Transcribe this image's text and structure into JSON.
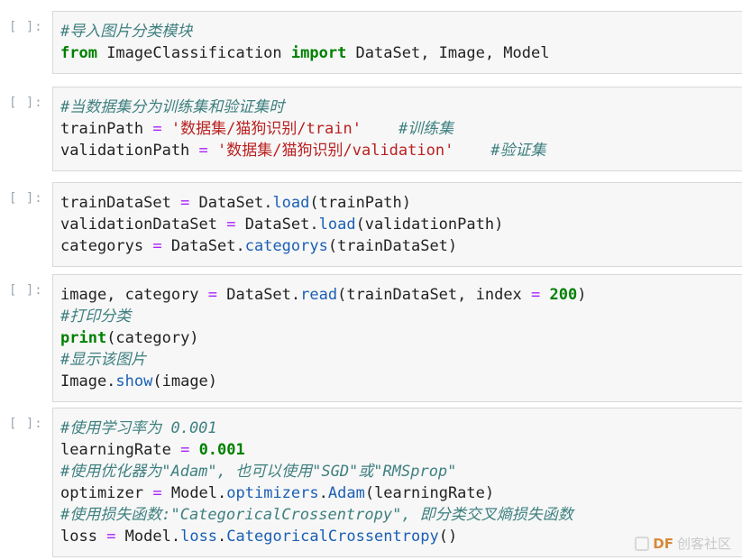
{
  "cells": [
    {
      "prompt": "[ ]:",
      "lines": [
        [
          {
            "t": "#导入图片分类模块",
            "c": "cm"
          }
        ],
        [
          {
            "t": "from",
            "c": "kw"
          },
          {
            "t": " ImageClassification ",
            "c": ""
          },
          {
            "t": "import",
            "c": "kw"
          },
          {
            "t": " DataSet, Image, Model",
            "c": ""
          }
        ]
      ]
    },
    {
      "prompt": "[ ]:",
      "lines": [
        [
          {
            "t": "#当数据集分为训练集和验证集时",
            "c": "cm"
          }
        ],
        [
          {
            "t": "trainPath ",
            "c": ""
          },
          {
            "t": "=",
            "c": "op"
          },
          {
            "t": " ",
            "c": ""
          },
          {
            "t": "'数据集/猫狗识别/train'",
            "c": "str"
          },
          {
            "t": "    ",
            "c": ""
          },
          {
            "t": "#训练集",
            "c": "cm"
          }
        ],
        [
          {
            "t": "validationPath ",
            "c": ""
          },
          {
            "t": "=",
            "c": "op"
          },
          {
            "t": " ",
            "c": ""
          },
          {
            "t": "'数据集/猫狗识别/validation'",
            "c": "str"
          },
          {
            "t": "    ",
            "c": ""
          },
          {
            "t": "#验证集",
            "c": "cm"
          }
        ]
      ]
    },
    {
      "prompt": "[ ]:",
      "lines": [
        [
          {
            "t": "trainDataSet ",
            "c": ""
          },
          {
            "t": "=",
            "c": "op"
          },
          {
            "t": " DataSet.",
            "c": ""
          },
          {
            "t": "load",
            "c": "fn"
          },
          {
            "t": "(trainPath)",
            "c": ""
          }
        ],
        [
          {
            "t": "validationDataSet ",
            "c": ""
          },
          {
            "t": "=",
            "c": "op"
          },
          {
            "t": " DataSet.",
            "c": ""
          },
          {
            "t": "load",
            "c": "fn"
          },
          {
            "t": "(validationPath)",
            "c": ""
          }
        ],
        [
          {
            "t": "categorys ",
            "c": ""
          },
          {
            "t": "=",
            "c": "op"
          },
          {
            "t": " DataSet.",
            "c": ""
          },
          {
            "t": "categorys",
            "c": "fn"
          },
          {
            "t": "(trainDataSet)",
            "c": ""
          }
        ]
      ]
    },
    {
      "prompt": "[ ]:",
      "lines": [
        [
          {
            "t": "image, category ",
            "c": ""
          },
          {
            "t": "=",
            "c": "op"
          },
          {
            "t": " DataSet.",
            "c": ""
          },
          {
            "t": "read",
            "c": "fn"
          },
          {
            "t": "(trainDataSet, index ",
            "c": ""
          },
          {
            "t": "=",
            "c": "op"
          },
          {
            "t": " ",
            "c": ""
          },
          {
            "t": "200",
            "c": "num"
          },
          {
            "t": ")",
            "c": ""
          }
        ],
        [
          {
            "t": "#打印分类",
            "c": "cm"
          }
        ],
        [
          {
            "t": "print",
            "c": "kw"
          },
          {
            "t": "(category)",
            "c": ""
          }
        ],
        [
          {
            "t": "#显示该图片",
            "c": "cm"
          }
        ],
        [
          {
            "t": "Image.",
            "c": ""
          },
          {
            "t": "show",
            "c": "fn"
          },
          {
            "t": "(image)",
            "c": ""
          }
        ]
      ]
    },
    {
      "prompt": "[ ]:",
      "lines": [
        [
          {
            "t": "#使用学习率为 0.001",
            "c": "cm"
          }
        ],
        [
          {
            "t": "learningRate ",
            "c": ""
          },
          {
            "t": "=",
            "c": "op"
          },
          {
            "t": " ",
            "c": ""
          },
          {
            "t": "0.001",
            "c": "num"
          }
        ],
        [
          {
            "t": "#使用优化器为\"Adam\", 也可以使用\"SGD\"或\"RMSprop\"",
            "c": "cm"
          }
        ],
        [
          {
            "t": "optimizer ",
            "c": ""
          },
          {
            "t": "=",
            "c": "op"
          },
          {
            "t": " Model.",
            "c": ""
          },
          {
            "t": "optimizers",
            "c": "fn"
          },
          {
            "t": ".",
            "c": ""
          },
          {
            "t": "Adam",
            "c": "fn"
          },
          {
            "t": "(learningRate)",
            "c": ""
          }
        ],
        [
          {
            "t": "#使用损失函数:\"CategoricalCrossentropy\", 即分类交叉熵损失函数",
            "c": "cm"
          }
        ],
        [
          {
            "t": "loss ",
            "c": ""
          },
          {
            "t": "=",
            "c": "op"
          },
          {
            "t": " Model.",
            "c": ""
          },
          {
            "t": "loss",
            "c": "fn"
          },
          {
            "t": ".",
            "c": ""
          },
          {
            "t": "CategoricalCrossentropy",
            "c": "fn"
          },
          {
            "t": "()",
            "c": ""
          }
        ]
      ]
    }
  ],
  "watermark": {
    "brand": "DF",
    "text": "创客社区"
  }
}
